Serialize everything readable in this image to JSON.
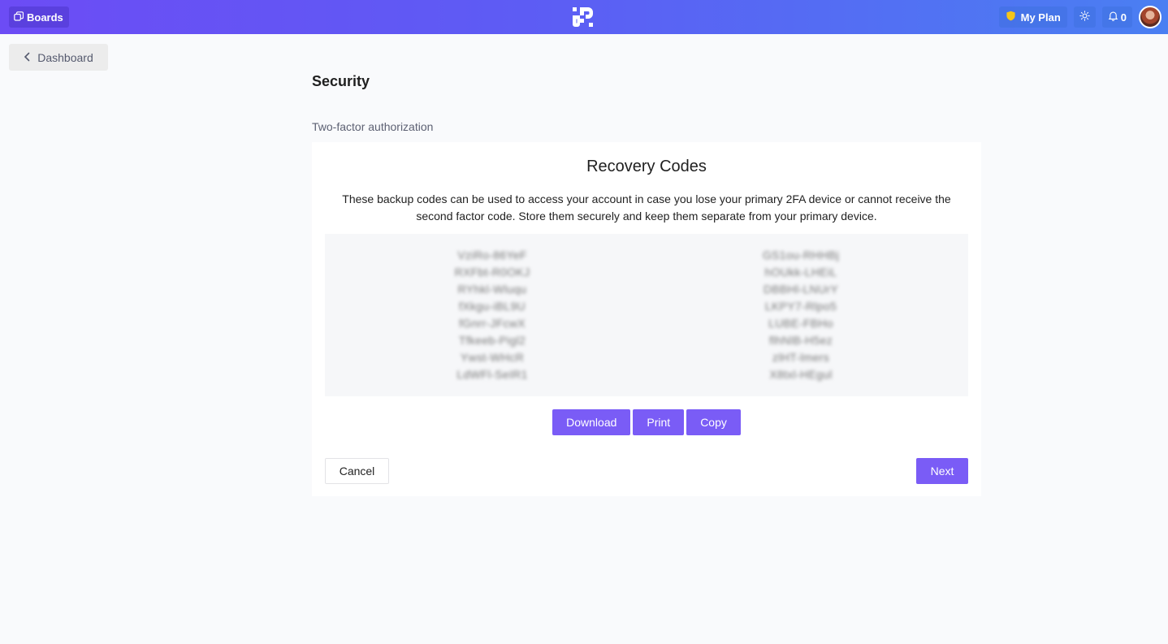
{
  "header": {
    "boards_label": "Boards",
    "plan_label": "My Plan",
    "notifications_count": "0",
    "colors": {
      "gradient_start": "#6c4cf5",
      "gradient_end": "#4a7ff2",
      "shield": "#f5c518"
    }
  },
  "nav": {
    "back_label": "Dashboard"
  },
  "page": {
    "title": "Security",
    "section_label": "Two-factor authorization"
  },
  "recovery": {
    "title": "Recovery Codes",
    "description": "These backup codes can be used to access your account in case you lose your primary 2FA device or cannot receive the second factor code. Store them securely and keep them separate from your primary device.",
    "codes_left": [
      "VziRo-86YeF",
      "RXFbt-R0OKJ",
      "RYhkl-Wluqu",
      "fXkgu-iBL9U",
      "fGnrr-JFcwX",
      "Tfkeeb-Pigl2",
      "Ywst-WHcR",
      "LdWFl-SeIR1"
    ],
    "codes_right": [
      "GS1ou-RHHBj",
      "hOUkk-LHEiL",
      "DBBHl-LNUrY",
      "LKPY7-Rlpo5",
      "LUBE-FBHo",
      "flhNlB-H5ez",
      "zlHT-lmers",
      "X8txl-HEgul"
    ],
    "codes_blurred": true,
    "actions": {
      "download": "Download",
      "print": "Print",
      "copy": "Copy"
    },
    "cancel_label": "Cancel",
    "next_label": "Next",
    "accent_color": "#7a5cf6"
  }
}
